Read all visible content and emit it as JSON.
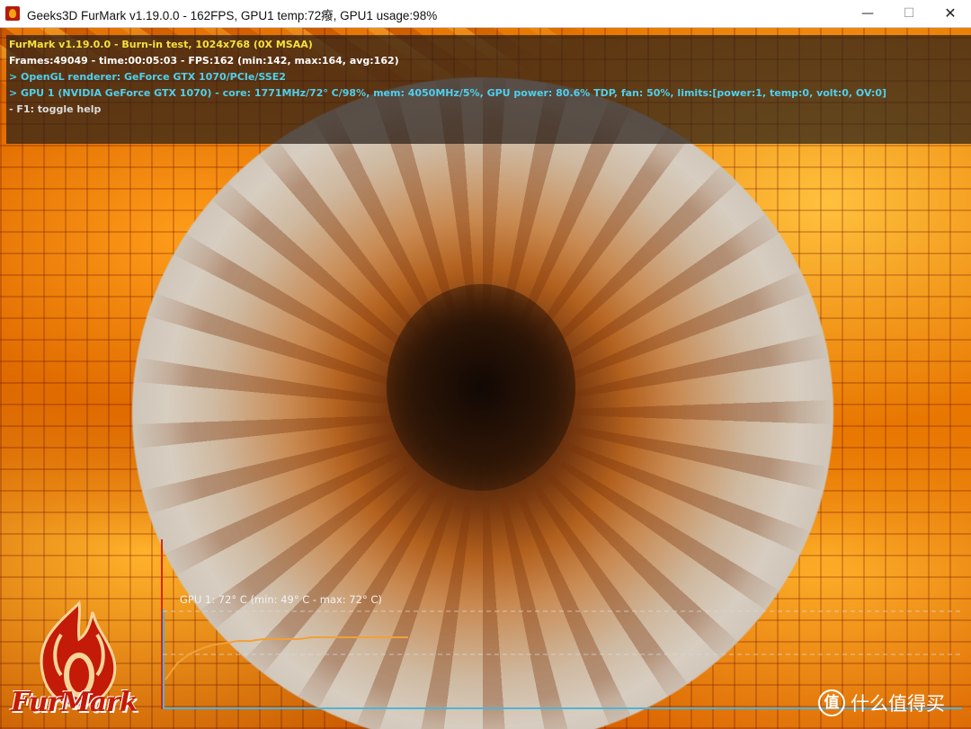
{
  "window": {
    "title": "Geeks3D FurMark v1.19.0.0 - 162FPS, GPU1 temp:72癈, GPU1 usage:98%",
    "min_glyph": "—",
    "max_glyph": "☐",
    "close_glyph": "✕"
  },
  "hud": {
    "line1": "FurMark v1.19.0.0 - Burn-in test, 1024x768 (0X MSAA)",
    "line2": "Frames:49049 - time:00:05:03 - FPS:162 (min:142, max:164, avg:162)",
    "line3": "> OpenGL renderer: GeForce GTX 1070/PCIe/SSE2",
    "line4": "> GPU 1 (NVIDIA GeForce GTX 1070) - core: 1771MHz/72° C/98%, mem: 4050MHz/5%, GPU power: 80.6% TDP, fan: 50%, limits:[power:1, temp:0, volt:0, OV:0]",
    "line5": "- F1: toggle help"
  },
  "graph": {
    "label": "GPU 1: 72° C (min: 49° C - max: 72° C)",
    "temps_c": [
      49,
      58,
      63,
      66,
      68,
      69,
      70,
      70,
      71,
      71,
      71,
      71,
      72,
      72,
      72,
      72,
      72,
      72,
      72,
      72,
      72
    ],
    "line_color": "#f2a038",
    "axis_color": "#4fb4d8"
  },
  "logo": {
    "text": "FurMark"
  },
  "watermark": {
    "badge": "值",
    "text": "什么值得买"
  }
}
